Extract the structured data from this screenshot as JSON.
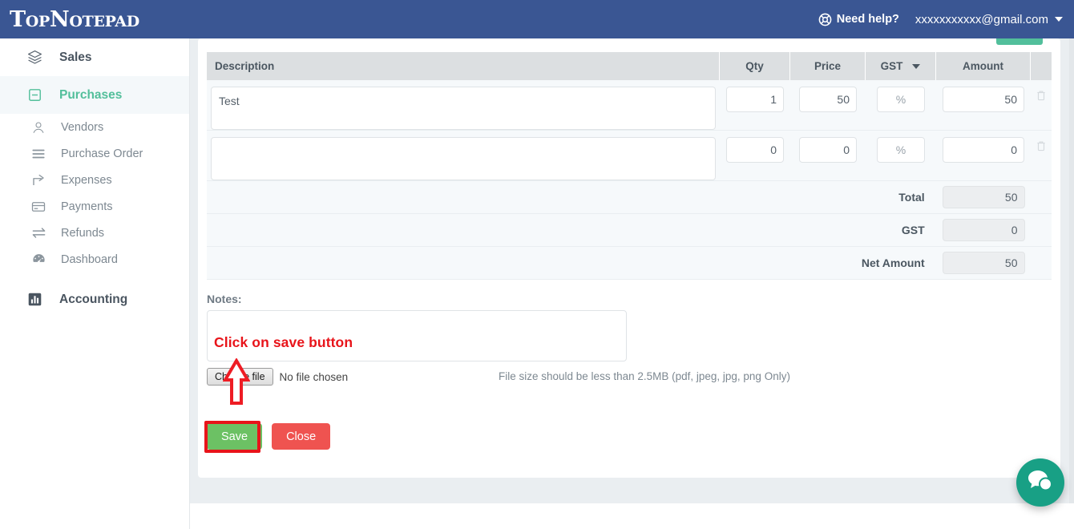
{
  "header": {
    "logo": "TopNotepad",
    "need_help_label": "Need help?",
    "need_help_icon": "life-ring-icon",
    "account_email": "xxxxxxxxxxx@gmail.com",
    "account_caret_icon": "caret-down-icon",
    "background_color": "#3a5693"
  },
  "sidebar": {
    "groups": [
      {
        "label": "Sales",
        "icon": "layers-icon",
        "active": false
      },
      {
        "label": "Purchases",
        "icon": "minus-square-icon",
        "active": true
      },
      {
        "label": "Accounting",
        "icon": "bar-chart-icon",
        "active": false
      }
    ],
    "purchases_items": [
      {
        "label": "Vendors",
        "icon": "user-icon"
      },
      {
        "label": "Purchase Order",
        "icon": "list-icon"
      },
      {
        "label": "Expenses",
        "icon": "share-icon"
      },
      {
        "label": "Payments",
        "icon": "credit-card-icon"
      },
      {
        "label": "Refunds",
        "icon": "exchange-icon"
      },
      {
        "label": "Dashboard",
        "icon": "dashboard-icon"
      }
    ],
    "active_color": "#53bf9b"
  },
  "items_table": {
    "columns": {
      "description": "Description",
      "qty": "Qty",
      "price": "Price",
      "gst": "GST",
      "gst_dropdown_icon": "chevron-down-icon",
      "amount": "Amount"
    },
    "rows": [
      {
        "description": "Test",
        "qty": "1",
        "price": "50",
        "gst": "%",
        "amount": "50",
        "delete_icon": "trash-icon"
      },
      {
        "description": "",
        "qty": "0",
        "price": "0",
        "gst": "%",
        "amount": "0",
        "delete_icon": "trash-icon"
      }
    ],
    "totals": [
      {
        "label": "Total",
        "value": "50"
      },
      {
        "label": "GST",
        "value": "0"
      },
      {
        "label": "Net Amount",
        "value": "50"
      }
    ]
  },
  "notes": {
    "label": "Notes:",
    "value": ""
  },
  "annotations": {
    "save_instruction": "Click on save button",
    "arrow_icon": "up-arrow-annotation",
    "highlight_color": "#e8141a"
  },
  "file_upload": {
    "button_label": "Choose file",
    "status": "No file chosen",
    "hint": "File size should be less than 2.5MB (pdf, jpeg, jpg, png Only)"
  },
  "actions": {
    "save_label": "Save",
    "close_label": "Close",
    "save_color": "#6cc164",
    "close_color": "#ef5350"
  },
  "chat": {
    "icon": "chat-bubbles-icon",
    "color": "#18a085"
  }
}
